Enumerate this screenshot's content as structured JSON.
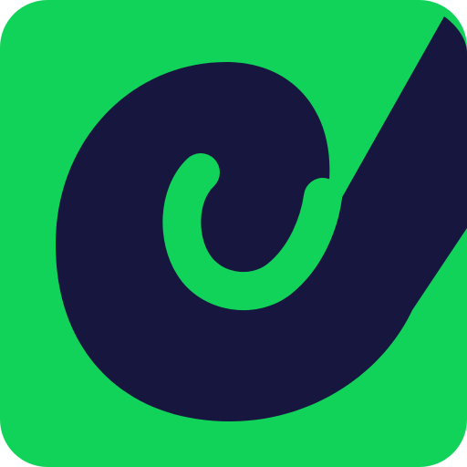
{
  "colors": {
    "background": "#ffffff",
    "tile_green": "#12d35a",
    "swirl_navy": "#17163f"
  },
  "icon": {
    "name": "swirl-logo-icon"
  }
}
